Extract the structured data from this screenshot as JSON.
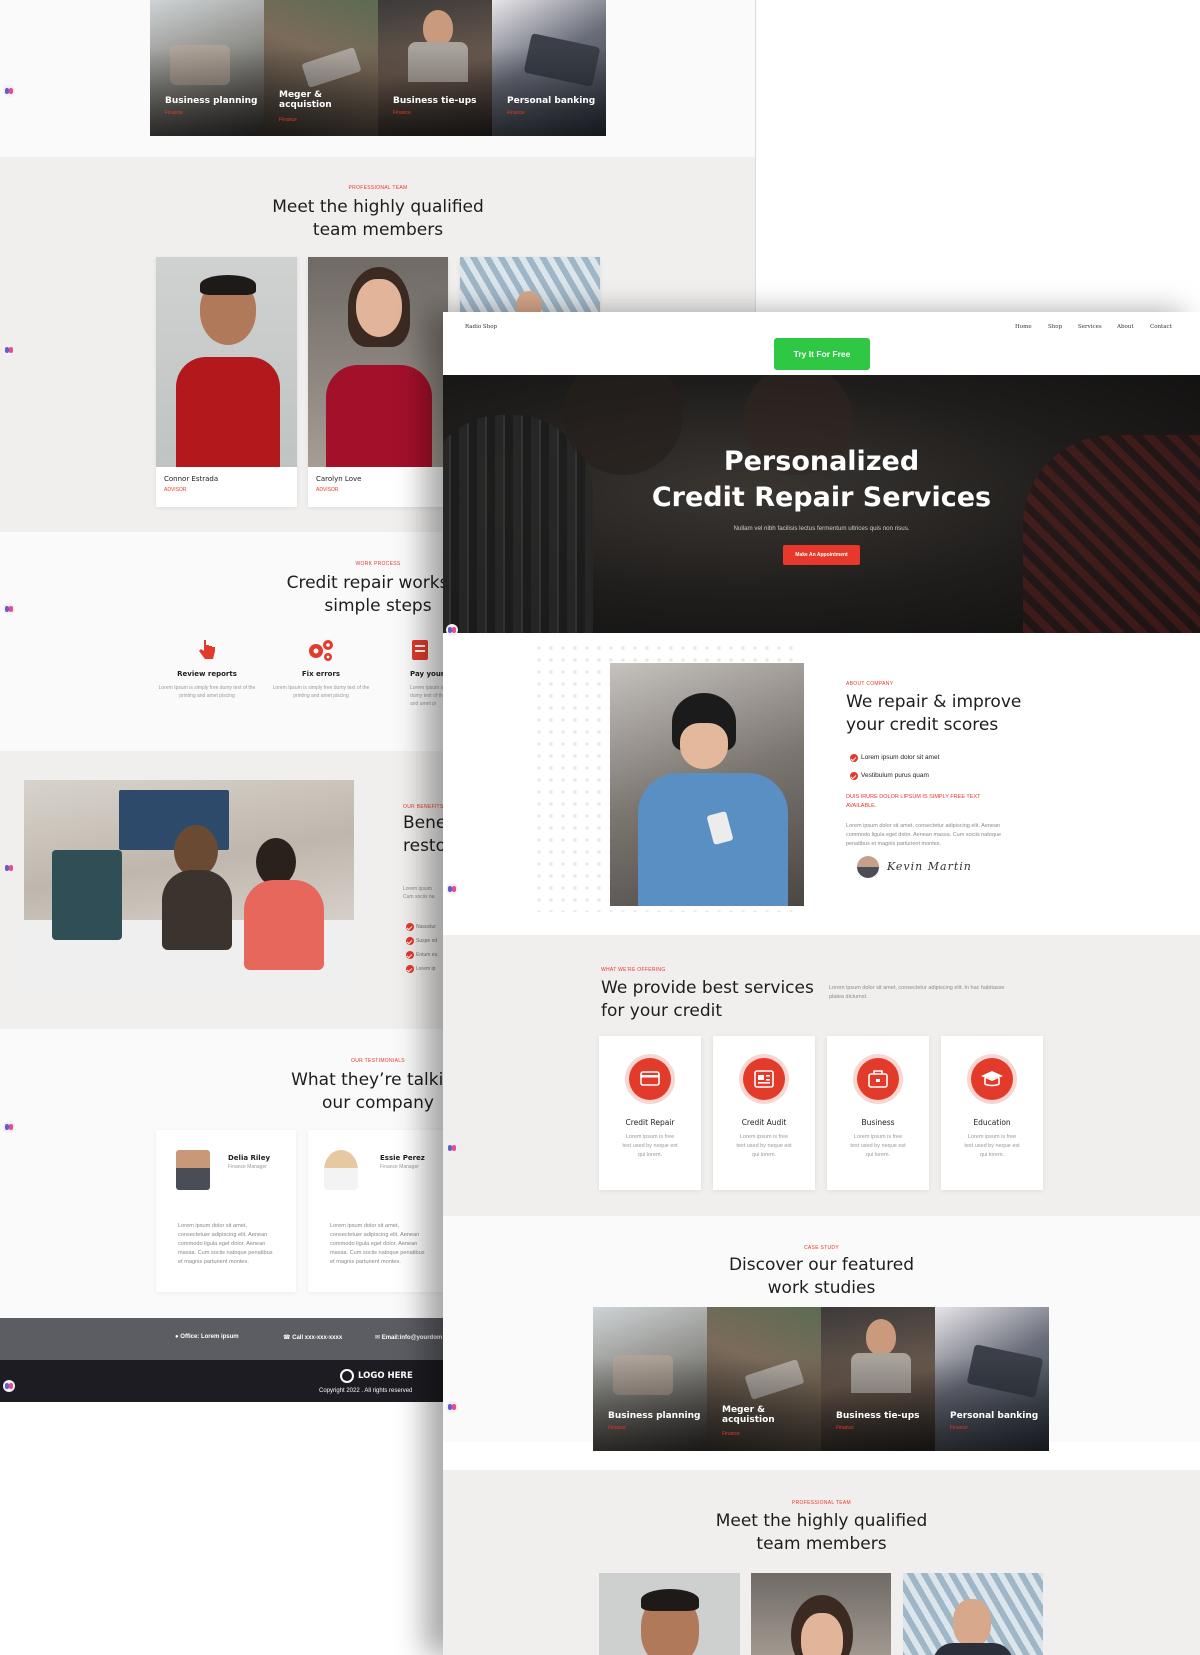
{
  "back_page": {
    "case_tiles": [
      {
        "title": "Business planning",
        "subtitle": "Finance"
      },
      {
        "title": "Meger & acquistion",
        "subtitle": "Finance"
      },
      {
        "title": "Business tie-ups",
        "subtitle": "Finance"
      },
      {
        "title": "Personal banking",
        "subtitle": "Finance"
      }
    ],
    "team": {
      "eyebrow": "PROFESSIONAL TEAM",
      "heading_line1": "Meet the highly qualified",
      "heading_line2": "team members",
      "members": [
        {
          "name": "Connor Estrada",
          "role": "ADVISOR"
        },
        {
          "name": "Carolyn Love",
          "role": "ADVISOR"
        }
      ]
    },
    "process": {
      "eyebrow": "WORK PROCESS",
      "heading_line1": "Credit repair works in",
      "heading_line2": "simple steps",
      "steps": [
        {
          "title": "Review reports",
          "desc": "Lorem Ipsum is simply free dumy text of the printing and amet piscing"
        },
        {
          "title": "Fix errors",
          "desc": "Lorem Ipsum is simply free dumy text of the printing and amet piscing"
        },
        {
          "title": "Pay your",
          "desc": "Lorem Ipsum is dumy text of the and amet pi"
        }
      ]
    },
    "benefits": {
      "eyebrow": "OUR BENEFITS",
      "heading_line1": "Bene",
      "heading_line2": "resto",
      "body_line1": "Lorem ipsum",
      "body_line2": "Cum sociis na",
      "items": [
        "Nascetur",
        "Suspe nd",
        "Entum eu",
        "Lorem ip"
      ]
    },
    "testimonials": {
      "eyebrow": "OUR TESTIMONIALS",
      "heading_line1": "What they’re talking",
      "heading_line2": "our company",
      "items": [
        {
          "name": "Delia Riley",
          "role": "Finance Manager",
          "quote": "Lorem ipsum dolor sit amet, consectetuer adipiscing elit. Aenean commodo ligula eget dolor. Aenean massa. Cum sociis natoque penatibus et magnis parturient montes."
        },
        {
          "name": "Essie Perez",
          "role": "Finance Manager",
          "quote": "Lorem ipsum dolor sit amet, consectetuer adipiscing elit. Aenean commodo ligula eget dolor. Aenean massa. Cum sociis natoque penatibus et magnis parturient montes."
        }
      ]
    },
    "contact": {
      "office": "Office: Lorem ipsum",
      "call": "Call xxx-xxx-xxxx",
      "email": "Email:info@yourdom"
    },
    "footer": {
      "logo": "LOGO HERE",
      "copyright": "Copyright 2022 . All rights reserved"
    }
  },
  "front_page": {
    "nav": {
      "brand": "Radio Shop",
      "links": [
        "Home",
        "Shop",
        "Services",
        "About",
        "Contact"
      ],
      "cta": "Try It For Free"
    },
    "hero": {
      "title_line1": "Personalized",
      "title_line2": "Credit Repair Services",
      "subtitle": "Nullam vel nibh facilisis lectus fermentum ultrices quis non risus.",
      "button": "Make An Appointment"
    },
    "about": {
      "eyebrow": "ABOUT COMPANY",
      "heading_line1": "We repair & improve",
      "heading_line2": "your credit scores",
      "bullets": [
        "Lorem ipsum dolor sit amet",
        "Vestibulum purus quam"
      ],
      "highlight_line1": "DUIS IRURE DOLOR LIPSUM IS SIMPLY FREE TEXT",
      "highlight_line2": "AVAILABLE.",
      "body": "Lorem ipsum dolor sit amet, consectetur adipiscing elit. Aenean commodo ligula eget dolor. Aenean massa. Cum sociis natoque penatibus et magnis parturient montes.",
      "signature": "Kevin Martin"
    },
    "services": {
      "eyebrow": "WHAT WE'RE OFFERING",
      "heading_line1": "We provide best services",
      "heading_line2": "for your credit",
      "intro": "Lorem ipsum dolor sit amet, consectetur adipiscing elit. In hac habitasse platea dictumst.",
      "cards": [
        {
          "title": "Credit Repair",
          "desc": "Lorem ipsum is free text used by neque est qui lorem.",
          "icon": "credit-card-icon"
        },
        {
          "title": "Credit Audit",
          "desc": "Lorem ipsum is free text used by neque est qui lorem.",
          "icon": "audit-report-icon"
        },
        {
          "title": "Business",
          "desc": "Lorem ipsum is free text used by neque est qui lorem.",
          "icon": "briefcase-icon"
        },
        {
          "title": "Education",
          "desc": "Lorem ipsum is free text used by neque est qui lorem.",
          "icon": "graduation-cap-icon"
        }
      ]
    },
    "case_study": {
      "eyebrow": "CASE STUDY",
      "heading_line1": "Discover our featured",
      "heading_line2": "work studies",
      "tiles": [
        {
          "title": "Business planning",
          "subtitle": "Finance"
        },
        {
          "title": "Meger & acquistion",
          "subtitle": "Finance"
        },
        {
          "title": "Business tie-ups",
          "subtitle": "Finance"
        },
        {
          "title": "Personal banking",
          "subtitle": "Finance"
        }
      ]
    },
    "team": {
      "eyebrow": "PROFESSIONAL TEAM",
      "heading_line1": "Meet the highly qualified",
      "heading_line2": "team members"
    }
  },
  "colors": {
    "accent": "#e8372b",
    "cta_green": "#2ec845",
    "footer_dark": "#1c1c22",
    "contact_gray": "#5c5d63"
  }
}
